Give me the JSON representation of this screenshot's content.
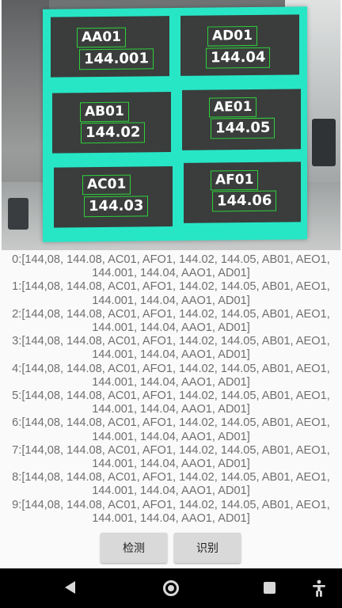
{
  "preview": {
    "panels": [
      {
        "code": "AA01",
        "value": "144.001"
      },
      {
        "code": "AD01",
        "value": "144.04"
      },
      {
        "code": "AB01",
        "value": "144.02"
      },
      {
        "code": "AE01",
        "value": "144.05"
      },
      {
        "code": "AC01",
        "value": "144.03"
      },
      {
        "code": "AF01",
        "value": "144.06"
      }
    ],
    "accent_color": "#27e6c6",
    "box_color": "#2fd03a"
  },
  "results": [
    "0:[144,08, 144.08, AC01, AFO1, 144.02, 144.05, AB01, AEO1, 144.001, 144.04, AAO1, AD01]",
    "1:[144,08, 144.08, AC01, AFO1, 144.02, 144.05, AB01, AEO1, 144.001, 144.04, AAO1, AD01]",
    "2:[144,08, 144.08, AC01, AFO1, 144.02, 144.05, AB01, AEO1, 144.001, 144.04, AAO1, AD01]",
    "3:[144,08, 144.08, AC01, AFO1, 144.02, 144.05, AB01, AEO1, 144.001, 144.04, AAO1, AD01]",
    "4:[144,08, 144.08, AC01, AFO1, 144.02, 144.05, AB01, AEO1, 144.001, 144.04, AAO1, AD01]",
    "5:[144,08, 144.08, AC01, AFO1, 144.02, 144.05, AB01, AEO1, 144.001, 144.04, AAO1, AD01]",
    "6:[144,08, 144.08, AC01, AFO1, 144.02, 144.05, AB01, AEO1, 144.001, 144.04, AAO1, AD01]",
    "7:[144,08, 144.08, AC01, AFO1, 144.02, 144.05, AB01, AEO1, 144.001, 144.04, AAO1, AD01]",
    "8:[144,08, 144.08, AC01, AFO1, 144.02, 144.05, AB01, AEO1, 144.001, 144.04, AAO1, AD01]",
    "9:[144,08, 144.08, AC01, AFO1, 144.02, 144.05, AB01, AEO1, 144.001, 144.04, AAO1, AD01]"
  ],
  "buttons": {
    "detect_label": "检测",
    "recognize_label": "识别"
  },
  "navbar": {
    "back_icon": "back-icon",
    "home_icon": "home-icon",
    "recents_icon": "recents-icon",
    "accessibility_icon": "accessibility-icon"
  }
}
